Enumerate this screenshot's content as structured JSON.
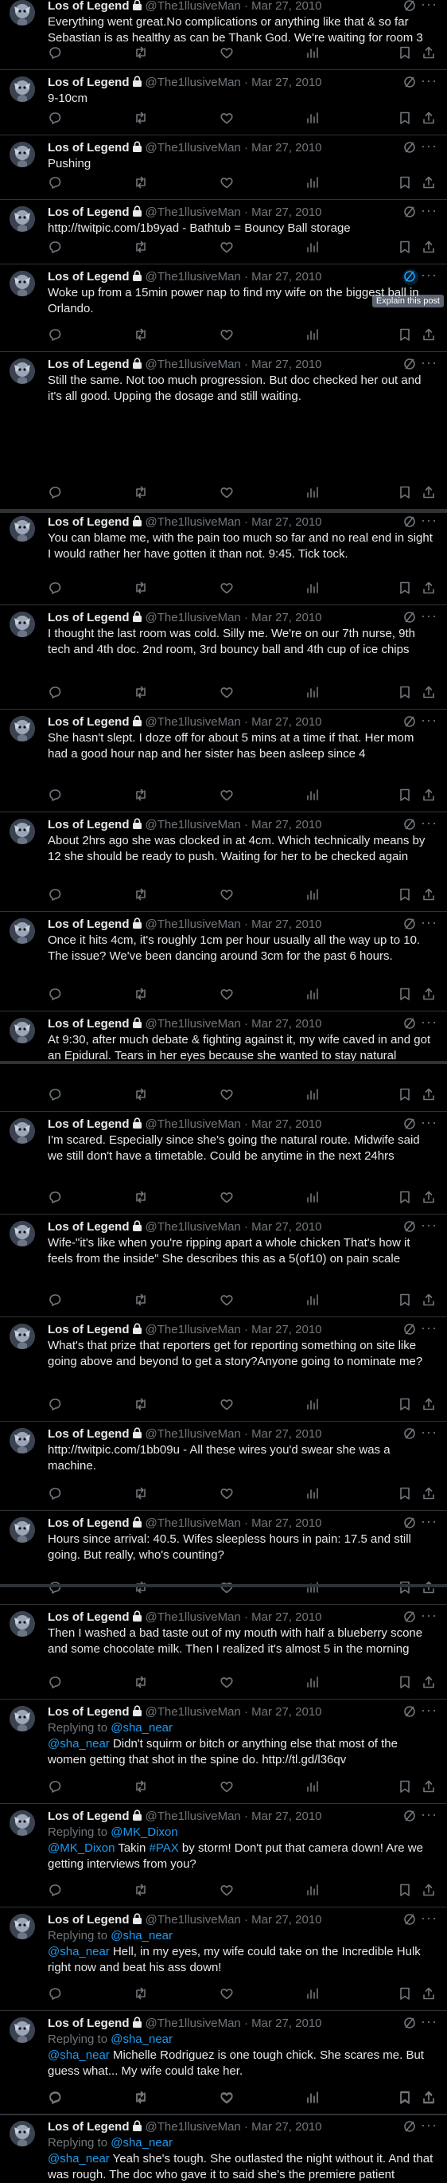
{
  "author": {
    "name": "Los of Legend",
    "handle": "@The1llusiveMan",
    "separator": "·"
  },
  "tooltip": "Explain this post",
  "tweets": [
    {
      "date": "Mar 27, 2010",
      "text": "Everything went great.No complications or anything like that & so far Sebastian is as healthy as can be Thank God. We're waiting for room 3"
    },
    {
      "date": "Mar 27, 2010",
      "text": "9-10cm"
    },
    {
      "date": "Mar 27, 2010",
      "text": "Pushing"
    },
    {
      "date": "Mar 27, 2010",
      "text": "http://twitpic.com/1b9yad - Bathtub = Bouncy Ball storage"
    },
    {
      "date": "Mar 27, 2010",
      "text": "Woke up from a 15min power nap to find my wife on the biggest ball in Orlando."
    },
    {
      "date": "Mar 27, 2010",
      "text": "Still the same. Not too much progression. But doc checked her out and it's all good. Upping the dosage and still waiting."
    },
    {
      "date": "Mar 27, 2010",
      "text": "You can blame me, with the pain too much so far and no real end in sight I would rather her have gotten it than not. 9:45. Tick tock."
    },
    {
      "date": "Mar 27, 2010",
      "text": "I thought the last room was cold. Silly me. We're on our 7th nurse, 9th tech and 4th doc. 2nd room, 3rd bouncy ball and 4th cup of ice chips"
    },
    {
      "date": "Mar 27, 2010",
      "text": "She hasn't slept. I doze off for about 5 mins at a time if that. Her mom had a good hour nap and her sister has been asleep since 4"
    },
    {
      "date": "Mar 27, 2010",
      "text": "About 2hrs ago she was clocked in at 4cm. Which technically means by 12 she should be ready to push. Waiting for her to be checked again"
    },
    {
      "date": "Mar 27, 2010",
      "text": "Once it hits 4cm, it's roughly 1cm per hour usually all the way up to 10. The issue? We've been dancing around 3cm for the past 6 hours."
    },
    {
      "date": "Mar 27, 2010",
      "text": "At 9:30, after much debate & fighting against it, my wife caved in and got an Epidural. Tears in her eyes because she wanted to stay natural"
    },
    {
      "date": "Mar 27, 2010",
      "text": "I'm scared. Especially since she's going the natural route. Midwife said we still don't have a timetable. Could be anytime in the next 24hrs"
    },
    {
      "date": "Mar 27, 2010",
      "text": "Wife-\"it's like when you're ripping apart a whole chicken That's how it feels from the inside\" She describes this as a 5(of10) on pain scale"
    },
    {
      "date": "Mar 27, 2010",
      "text": "What's that prize that reporters get for reporting something on site like going above and beyond to get a story?Anyone going to nominate me?"
    },
    {
      "date": "Mar 27, 2010",
      "text": "http://twitpic.com/1bb09u - All these wires you'd swear she was a machine."
    },
    {
      "date": "Mar 27, 2010",
      "text": "Hours since arrival: 40.5. Wifes sleepless hours in pain: 17.5 and still going. But really, who's counting?"
    },
    {
      "date": "Mar 27, 2010",
      "text": "Then I washed a bad taste out of my mouth with half a blueberry scone and some chocolate milk. Then I realized it's almost 5 in the morning"
    },
    {
      "date": "Mar 27, 2010",
      "reply_label": "Replying to",
      "reply_to": "@sha_near",
      "mention": "@sha_near",
      "text": " Didn't squirm or bitch or anything else that most of the women getting that shot in the spine do. http://tl.gd/l36qv"
    },
    {
      "date": "Mar 27, 2010",
      "reply_label": "Replying to",
      "reply_to": "@MK_Dixon",
      "mention": "@MK_Dixon",
      "text_a": " Takin ",
      "hashtag": "#PAX",
      "text": " by storm! Don't put that camera down! Are we getting interviews from you?"
    },
    {
      "date": "Mar 27, 2010",
      "reply_label": "Replying to",
      "reply_to": "@sha_near",
      "mention": "@sha_near",
      "text": " Hell, in my eyes, my wife could take on the Incredible Hulk right now and beat his ass down!"
    },
    {
      "date": "Mar 27, 2010",
      "reply_label": "Replying to",
      "reply_to": "@sha_near",
      "mention": "@sha_near",
      "text": " Michelle Rodriguez is one tough chick. She scares me. But guess what... My wife could take her."
    },
    {
      "date": "Mar 27, 2010",
      "reply_label": "Replying to",
      "reply_to": "@sha_near",
      "mention": "@sha_near",
      "text": " Yeah she's tough. She outlasted the night without it. And that was rough. The doc who gave it to said she's the premiere patient"
    }
  ],
  "icons": {
    "reply": "reply-icon",
    "retweet": "retweet-icon",
    "like": "like-icon",
    "views": "views-icon",
    "bookmark": "bookmark-icon",
    "share": "share-icon",
    "grok": "grok-icon",
    "more": "more-icon",
    "lock": "lock-icon"
  },
  "colors": {
    "background": "#000000",
    "text": "#e7e9ea",
    "muted": "#71767b",
    "accent": "#1d9bf0",
    "border": "#2f3336"
  }
}
